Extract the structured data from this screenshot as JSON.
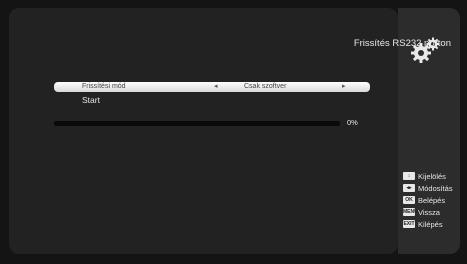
{
  "header": {
    "title": "Frissítés RS232 porton",
    "icon": "gears-icon"
  },
  "menu": {
    "items": [
      {
        "label": "Frissítési mód",
        "value": "Csak szoftver",
        "selected": true
      },
      {
        "label": "Start",
        "value": ""
      }
    ]
  },
  "progress": {
    "percent_label": "0%",
    "value": 0
  },
  "legend": {
    "items": [
      {
        "key": "↕",
        "label": "Kijelölés",
        "icon": "updown-key-icon"
      },
      {
        "key": "◂▸",
        "label": "Módosítás",
        "icon": "leftright-key-icon"
      },
      {
        "key": "OK",
        "label": "Belépés",
        "icon": "ok-key-icon"
      },
      {
        "key": "MENU",
        "label": "Vissza",
        "icon": "menu-key-icon"
      },
      {
        "key": "EXIT",
        "label": "Kilépés",
        "icon": "exit-key-icon"
      }
    ]
  },
  "colors": {
    "background": "#222222",
    "highlight": "#ffffff",
    "text": "#e6e6e6"
  }
}
